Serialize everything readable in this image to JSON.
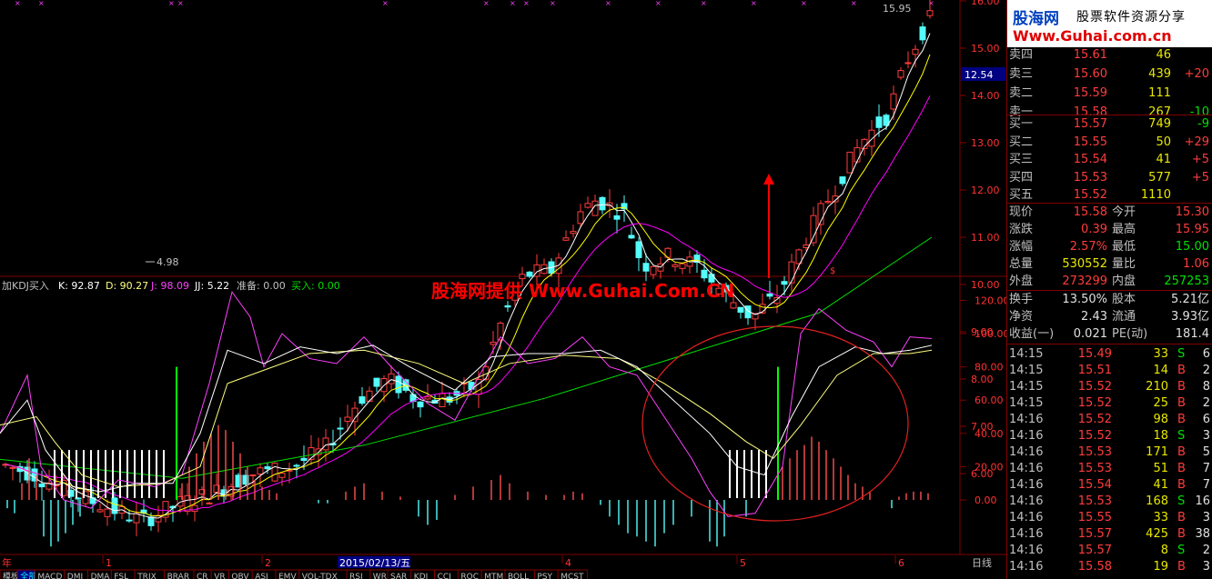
{
  "price_axis": [
    "16.00",
    "15.00",
    "14.00",
    "13.00",
    "12.00",
    "11.00",
    "10.00",
    "9.00",
    "8.00",
    "7.00",
    "6.00"
  ],
  "price_axis_values": [
    16,
    15,
    14,
    13,
    12,
    11,
    10,
    9,
    8,
    7,
    6
  ],
  "kdj_axis": [
    "120.00",
    "100.00",
    "80.00",
    "60.00",
    "40.00",
    "20.00",
    "0.00"
  ],
  "kdj_axis_values": [
    120,
    100,
    80,
    60,
    40,
    20,
    0
  ],
  "cursor_price": "12.54",
  "high_label": "15.95",
  "low_label": "4.98",
  "indicator": {
    "name": "加KDJ买入",
    "k": "K: 92.87",
    "d": "D: 90.27",
    "j": "J: 98.09",
    "jj": "JJ: 5.22",
    "ready": "准备: 0.00",
    "buy": "买入: 0.00"
  },
  "watermark": "股海网提供 Www.Guhai.Com.CN",
  "logo": {
    "name": "股海网",
    "slogan": "股票软件资源分享",
    "url": "Www.Guhai.com.cn"
  },
  "time_axis": {
    "start": "年",
    "labels": [
      "1",
      "2",
      "4",
      "5",
      "6"
    ],
    "cursor_date": "2015/02/13/五",
    "period": "日线"
  },
  "bottom_tabs": [
    "模板",
    "全部",
    "MACD",
    "DMI",
    "DMA",
    "FSL",
    "TRIX",
    "BRAR",
    "CR",
    "VR",
    "OBV",
    "ASI",
    "EMV",
    "VOL-TDX",
    "RSI",
    "WR",
    "SAR",
    "KDJ",
    "CCI",
    "ROC",
    "MTM",
    "BOLL",
    "PSY",
    "MCST"
  ],
  "order_book": {
    "asks": [
      {
        "label": "卖四",
        "price": "15.61",
        "vol": "46",
        "chg": ""
      },
      {
        "label": "卖三",
        "price": "15.60",
        "vol": "439",
        "chg": "+20"
      },
      {
        "label": "卖二",
        "price": "15.59",
        "vol": "111",
        "chg": ""
      },
      {
        "label": "卖一",
        "price": "15.58",
        "vol": "267",
        "chg": "-10"
      }
    ],
    "bids": [
      {
        "label": "买一",
        "price": "15.57",
        "vol": "749",
        "chg": "-9"
      },
      {
        "label": "买二",
        "price": "15.55",
        "vol": "50",
        "chg": "+29"
      },
      {
        "label": "买三",
        "price": "15.54",
        "vol": "41",
        "chg": "+5"
      },
      {
        "label": "买四",
        "price": "15.53",
        "vol": "577",
        "chg": "+5"
      },
      {
        "label": "买五",
        "price": "15.52",
        "vol": "1110",
        "chg": ""
      }
    ]
  },
  "stats": [
    {
      "l1": "现价",
      "v1": "15.58",
      "l2": "今开",
      "v2": "15.30"
    },
    {
      "l1": "涨跌",
      "v1": "0.39",
      "l2": "最高",
      "v2": "15.95"
    },
    {
      "l1": "涨幅",
      "v1": "2.57%",
      "l2": "最低",
      "v2": "15.00"
    },
    {
      "l1": "总量",
      "v1": "530552",
      "l2": "量比",
      "v2": "1.06"
    },
    {
      "l1": "外盘",
      "v1": "273299",
      "l2": "内盘",
      "v2": "257253"
    }
  ],
  "stats2": [
    {
      "l1": "换手",
      "v1": "13.50%",
      "l2": "股本",
      "v2": "5.21亿"
    },
    {
      "l1": "净资",
      "v1": "2.43",
      "l2": "流通",
      "v2": "3.93亿"
    },
    {
      "l1": "收益(一)",
      "v1": "0.021",
      "l2": "PE(动)",
      "v2": "181.4"
    }
  ],
  "ticks": [
    {
      "t": "14:15",
      "p": "15.49",
      "v": "33",
      "s": "S",
      "n": "6"
    },
    {
      "t": "14:15",
      "p": "15.51",
      "v": "14",
      "s": "B",
      "n": "2"
    },
    {
      "t": "14:15",
      "p": "15.52",
      "v": "210",
      "s": "B",
      "n": "8"
    },
    {
      "t": "14:15",
      "p": "15.52",
      "v": "25",
      "s": "B",
      "n": "2"
    },
    {
      "t": "14:16",
      "p": "15.52",
      "v": "98",
      "s": "B",
      "n": "6"
    },
    {
      "t": "14:16",
      "p": "15.52",
      "v": "18",
      "s": "S",
      "n": "3"
    },
    {
      "t": "14:16",
      "p": "15.53",
      "v": "171",
      "s": "B",
      "n": "5"
    },
    {
      "t": "14:16",
      "p": "15.53",
      "v": "51",
      "s": "B",
      "n": "7"
    },
    {
      "t": "14:16",
      "p": "15.54",
      "v": "41",
      "s": "B",
      "n": "7"
    },
    {
      "t": "14:16",
      "p": "15.53",
      "v": "168",
      "s": "S",
      "n": "16"
    },
    {
      "t": "14:16",
      "p": "15.55",
      "v": "33",
      "s": "B",
      "n": "3"
    },
    {
      "t": "14:16",
      "p": "15.57",
      "v": "425",
      "s": "B",
      "n": "38"
    },
    {
      "t": "14:16",
      "p": "15.57",
      "v": "8",
      "s": "S",
      "n": "2"
    },
    {
      "t": "14:16",
      "p": "15.58",
      "v": "19",
      "s": "B",
      "n": "3"
    }
  ],
  "colors": {
    "up": "#ff3c3c",
    "down": "#54fcfc",
    "ma5": "#ffffff",
    "ma10": "#ffff00",
    "ma20": "#ff00ff",
    "ma60": "#00e000",
    "k": "#ffffff",
    "d": "#ffff80",
    "j": "#ff40ff",
    "grid": "#800000"
  }
}
